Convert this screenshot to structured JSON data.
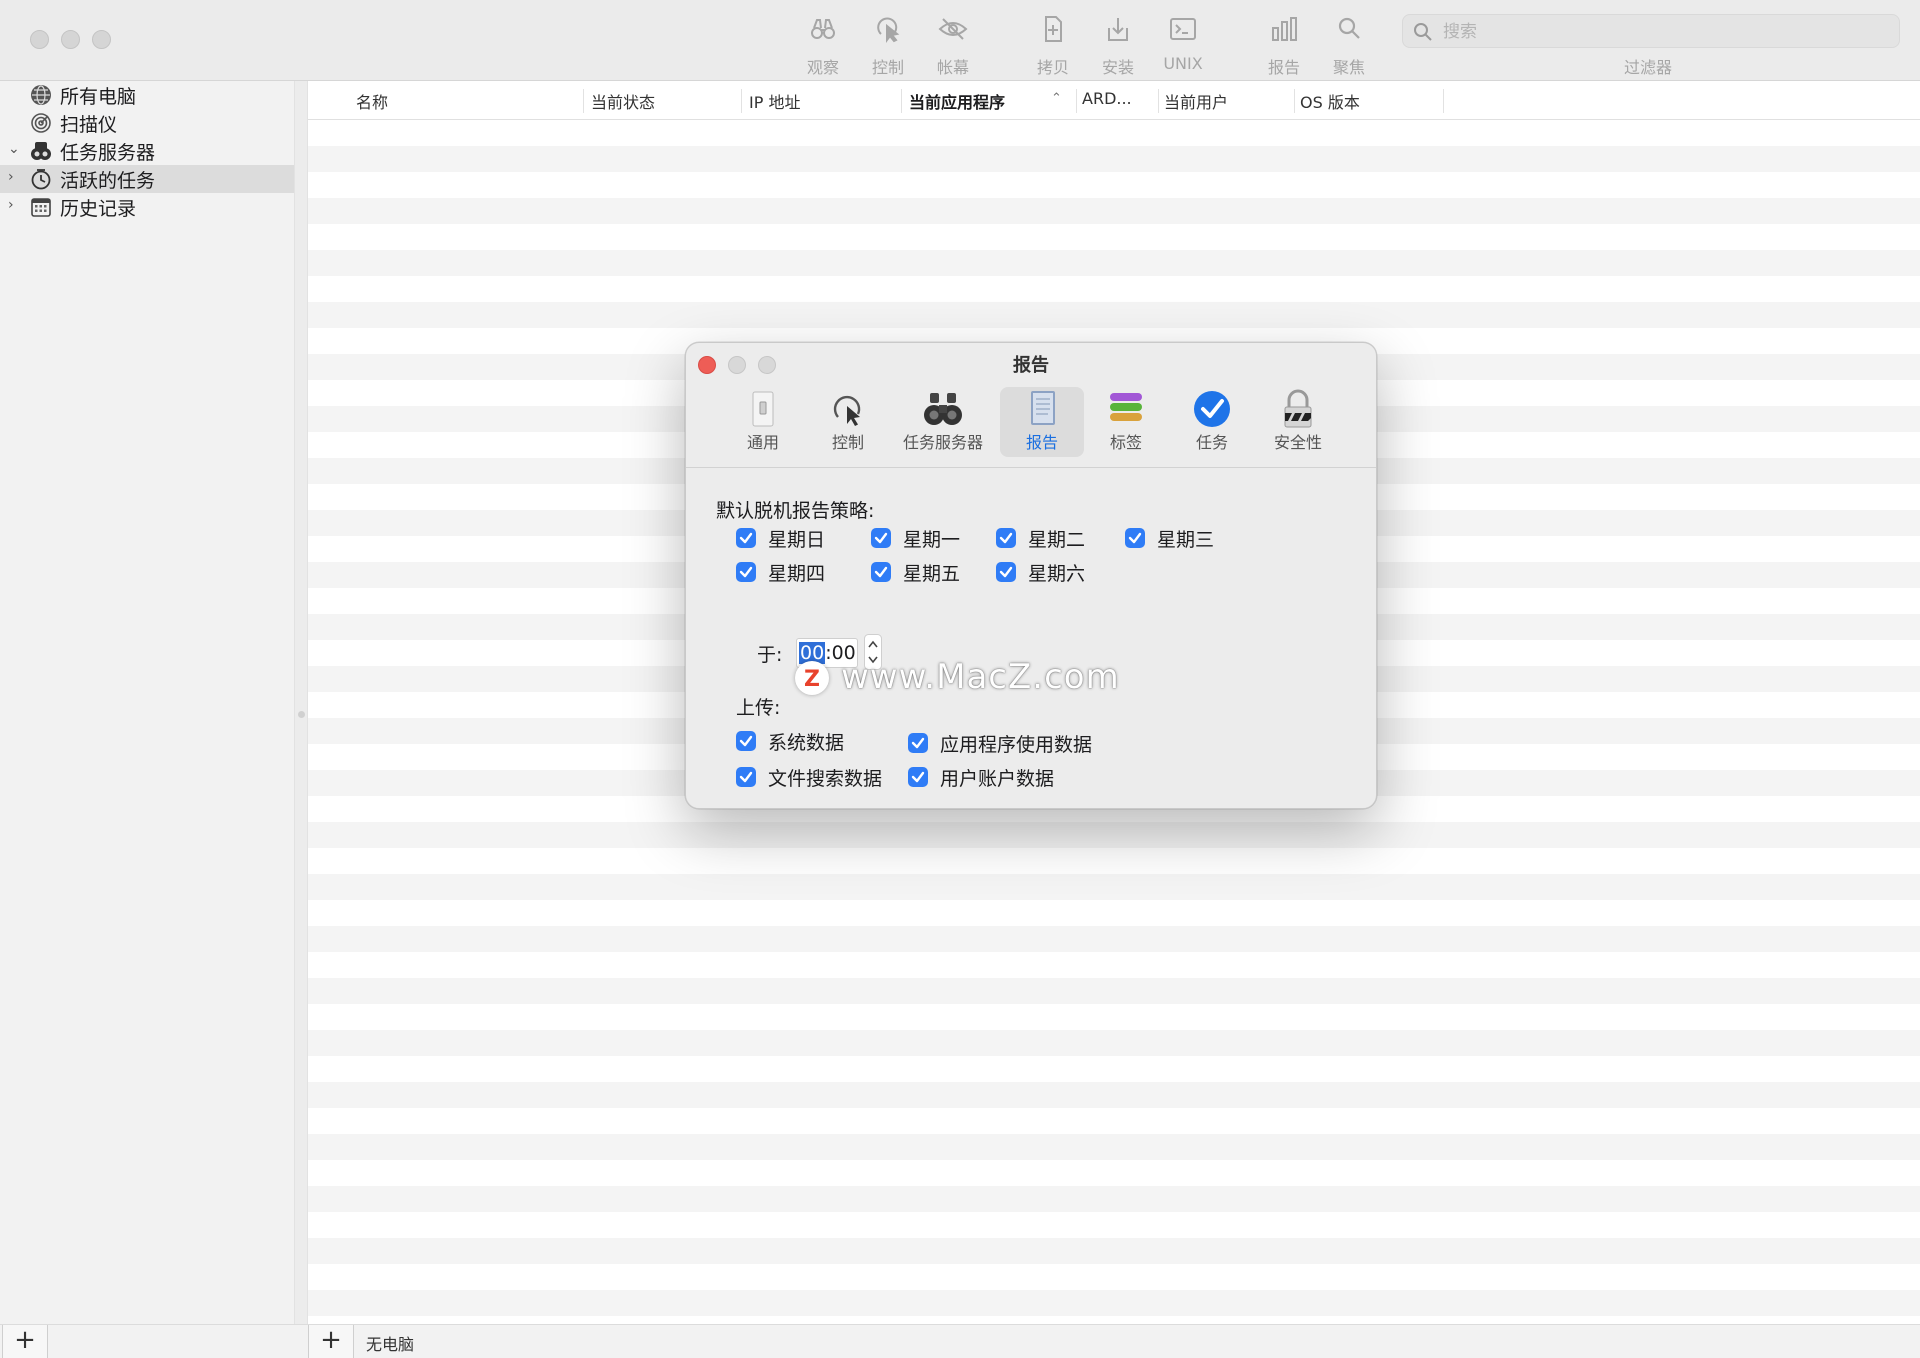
{
  "toolbar": {
    "buttons": [
      {
        "label": "观察",
        "icon": "binoculars-icon"
      },
      {
        "label": "控制",
        "icon": "cursor-icon"
      },
      {
        "label": "帐幕",
        "icon": "eye-slash-icon"
      },
      {
        "label": "拷贝",
        "icon": "document-copy-icon"
      },
      {
        "label": "安装",
        "icon": "install-icon"
      },
      {
        "label": "UNIX",
        "icon": "terminal-icon"
      },
      {
        "label": "报告",
        "icon": "bar-chart-icon"
      },
      {
        "label": "聚焦",
        "icon": "magnifier-icon"
      }
    ],
    "search_placeholder": "搜索",
    "filter_label": "过滤器"
  },
  "sidebar": {
    "items": [
      {
        "label": "所有电脑",
        "icon": "globe-icon",
        "disclosure": ""
      },
      {
        "label": "扫描仪",
        "icon": "scanner-icon",
        "disclosure": ""
      },
      {
        "label": "任务服务器",
        "icon": "task-server-icon",
        "disclosure": "expanded"
      },
      {
        "label": "活跃的任务",
        "icon": "clock-icon",
        "disclosure": "collapsed",
        "selected": true
      },
      {
        "label": "历史记录",
        "icon": "calendar-icon",
        "disclosure": "collapsed"
      }
    ]
  },
  "table": {
    "columns": [
      "名称",
      "当前状态",
      "IP 地址",
      "当前应用程序",
      "ARD...",
      "当前用户",
      "OS 版本"
    ],
    "sorted_column": "当前应用程序"
  },
  "bottom": {
    "add_label": "+",
    "status": "无电脑"
  },
  "dialog": {
    "title": "报告",
    "tabs": [
      {
        "label": "通用",
        "icon": "switch-icon"
      },
      {
        "label": "控制",
        "icon": "cursor-icon"
      },
      {
        "label": "任务服务器",
        "icon": "binoculars-icon"
      },
      {
        "label": "报告",
        "icon": "report-icon",
        "active": true
      },
      {
        "label": "标签",
        "icon": "tags-icon"
      },
      {
        "label": "任务",
        "icon": "checkmark-circle-icon"
      },
      {
        "label": "安全性",
        "icon": "lock-icon"
      }
    ],
    "policy_label": "默认脱机报告策略:",
    "days": [
      {
        "label": "星期日",
        "checked": true
      },
      {
        "label": "星期一",
        "checked": true
      },
      {
        "label": "星期二",
        "checked": true
      },
      {
        "label": "星期三",
        "checked": true
      },
      {
        "label": "星期四",
        "checked": true
      },
      {
        "label": "星期五",
        "checked": true
      },
      {
        "label": "星期六",
        "checked": true
      }
    ],
    "at_label": "于:",
    "time_hours": "00",
    "time_minutes": "00",
    "upload_label": "上传:",
    "uploads": [
      {
        "label": "系统数据",
        "checked": true
      },
      {
        "label": "应用程序使用数据",
        "checked": true
      },
      {
        "label": "文件搜索数据",
        "checked": true
      },
      {
        "label": "用户账户数据",
        "checked": true
      }
    ]
  },
  "watermark": {
    "text": "www.MacZ.com",
    "logo": "Z"
  },
  "colors": {
    "accent": "#2f7cf6",
    "close": "#ee5d56",
    "toolbar": "#ebebeb",
    "sidebar": "#f2f2f2"
  }
}
